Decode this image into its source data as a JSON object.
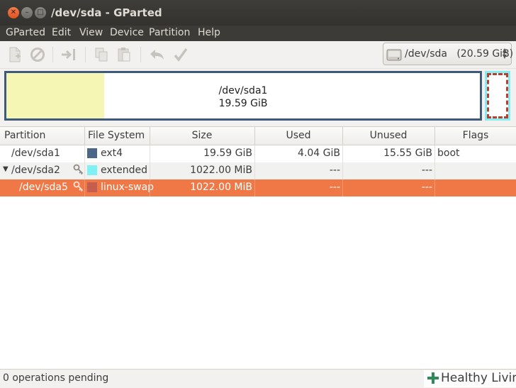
{
  "window": {
    "title": "/dev/sda - GParted"
  },
  "menu": [
    "GParted",
    "Edit",
    "View",
    "Device",
    "Partition",
    "Help"
  ],
  "toolbar": {
    "buttons": [
      "new-icon",
      "delete-icon",
      "resize-icon",
      "copy-icon",
      "paste-icon",
      "undo-icon",
      "apply-icon"
    ]
  },
  "device_selector": {
    "device": "/dev/sda",
    "size": "(20.59 GiB)"
  },
  "disk_map": {
    "name": "/dev/sda1",
    "size": "19.59 GiB",
    "used_fraction": 0.206,
    "colors": {
      "border": "#3e5a7a",
      "used": "#f6f6b4",
      "extended": "#7ff0f4",
      "swap": "#c23c2c"
    }
  },
  "table": {
    "headers": {
      "partition": "Partition",
      "filesystem": "File System",
      "size": "Size",
      "used": "Used",
      "unused": "Unused",
      "flags": "Flags"
    },
    "rows": [
      {
        "partition": "/dev/sda1",
        "filesystem": "ext4",
        "fs_color": "#4a6688",
        "size": "19.59 GiB",
        "used": "4.04 GiB",
        "unused": "15.55 GiB",
        "flags": "boot"
      },
      {
        "partition": "/dev/sda2",
        "filesystem": "extended",
        "fs_color": "#7ff0f4",
        "size": "1022.00 MiB",
        "used": "---",
        "unused": "---",
        "flags": ""
      },
      {
        "partition": "/dev/sda5",
        "filesystem": "linux-swap",
        "fs_color": "#c45e50",
        "size": "1022.00 MiB",
        "used": "---",
        "unused": "---",
        "flags": ""
      }
    ]
  },
  "status": {
    "text": "0 operations pending"
  },
  "watermark": {
    "text": "Healthy Living"
  }
}
